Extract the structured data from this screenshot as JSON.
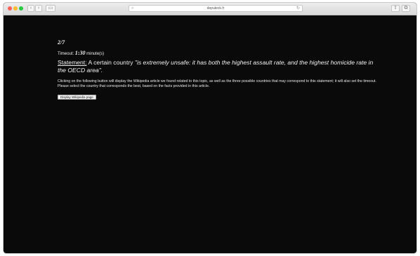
{
  "browser": {
    "address_url": "deputeck.fr",
    "icons": {
      "back": "chevron-left-icon",
      "forward": "chevron-right-icon",
      "sidebar": "sidebar-icon",
      "lock": "lock-icon",
      "reload": "reload-icon",
      "share": "share-icon",
      "tabs": "tabs-icon"
    }
  },
  "page": {
    "progress": "2/7",
    "timeout_label": "Timeout:",
    "timeout_value": "1:30",
    "timeout_unit": "minute(s)",
    "statement_label": "Statement:",
    "statement_prefix": "A certain country",
    "statement_quote": "\"is extremely unsafe: it has both the highest assault rate, and the highest homicide rate in the OECD area\".",
    "instructions": "Clicking on the following button will display the Wikipedia article we found related to this topic, as well as the three possible countries that may correspond to this statement; it will also set the timeout. Please select the country that corresponds the best, based on the facts provided in this article.",
    "wiki_button_label": "Display Wikipedia page"
  },
  "colors": {
    "background": "#0a0a0a",
    "text": "#f2f2f2"
  }
}
